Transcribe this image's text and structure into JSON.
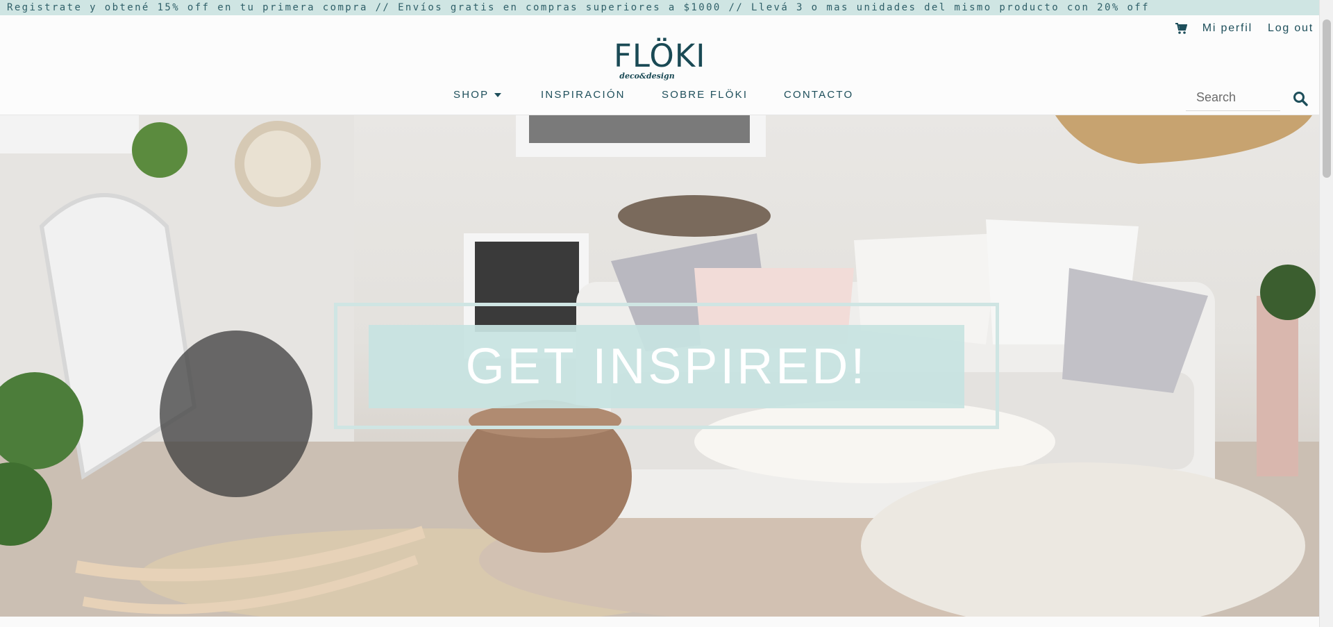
{
  "promo": {
    "text": "Registrate y obtené 15% off en tu primera compra // Envíos gratis en compras superiores a $1000 // Llevá 3 o mas unidades del mismo producto con 20% off"
  },
  "brand": {
    "name": "FLÖKI",
    "tagline": "deco&design"
  },
  "user_nav": {
    "cart_icon": "shopping-cart-icon",
    "profile_label": "Mi perfil",
    "logout_label": "Log out"
  },
  "nav": {
    "items": [
      {
        "label": "SHOP",
        "has_dropdown": true
      },
      {
        "label": "INSPIRACIÓN"
      },
      {
        "label": "SOBRE FLÖKI"
      },
      {
        "label": "CONTACTO"
      }
    ]
  },
  "search": {
    "placeholder": "Search",
    "icon": "search-icon"
  },
  "hero": {
    "cta_label": "GET INSPIRED!"
  },
  "colors": {
    "accent": "#cfe5e3",
    "brand": "#1a4a55",
    "text": "#1d4e5a"
  }
}
